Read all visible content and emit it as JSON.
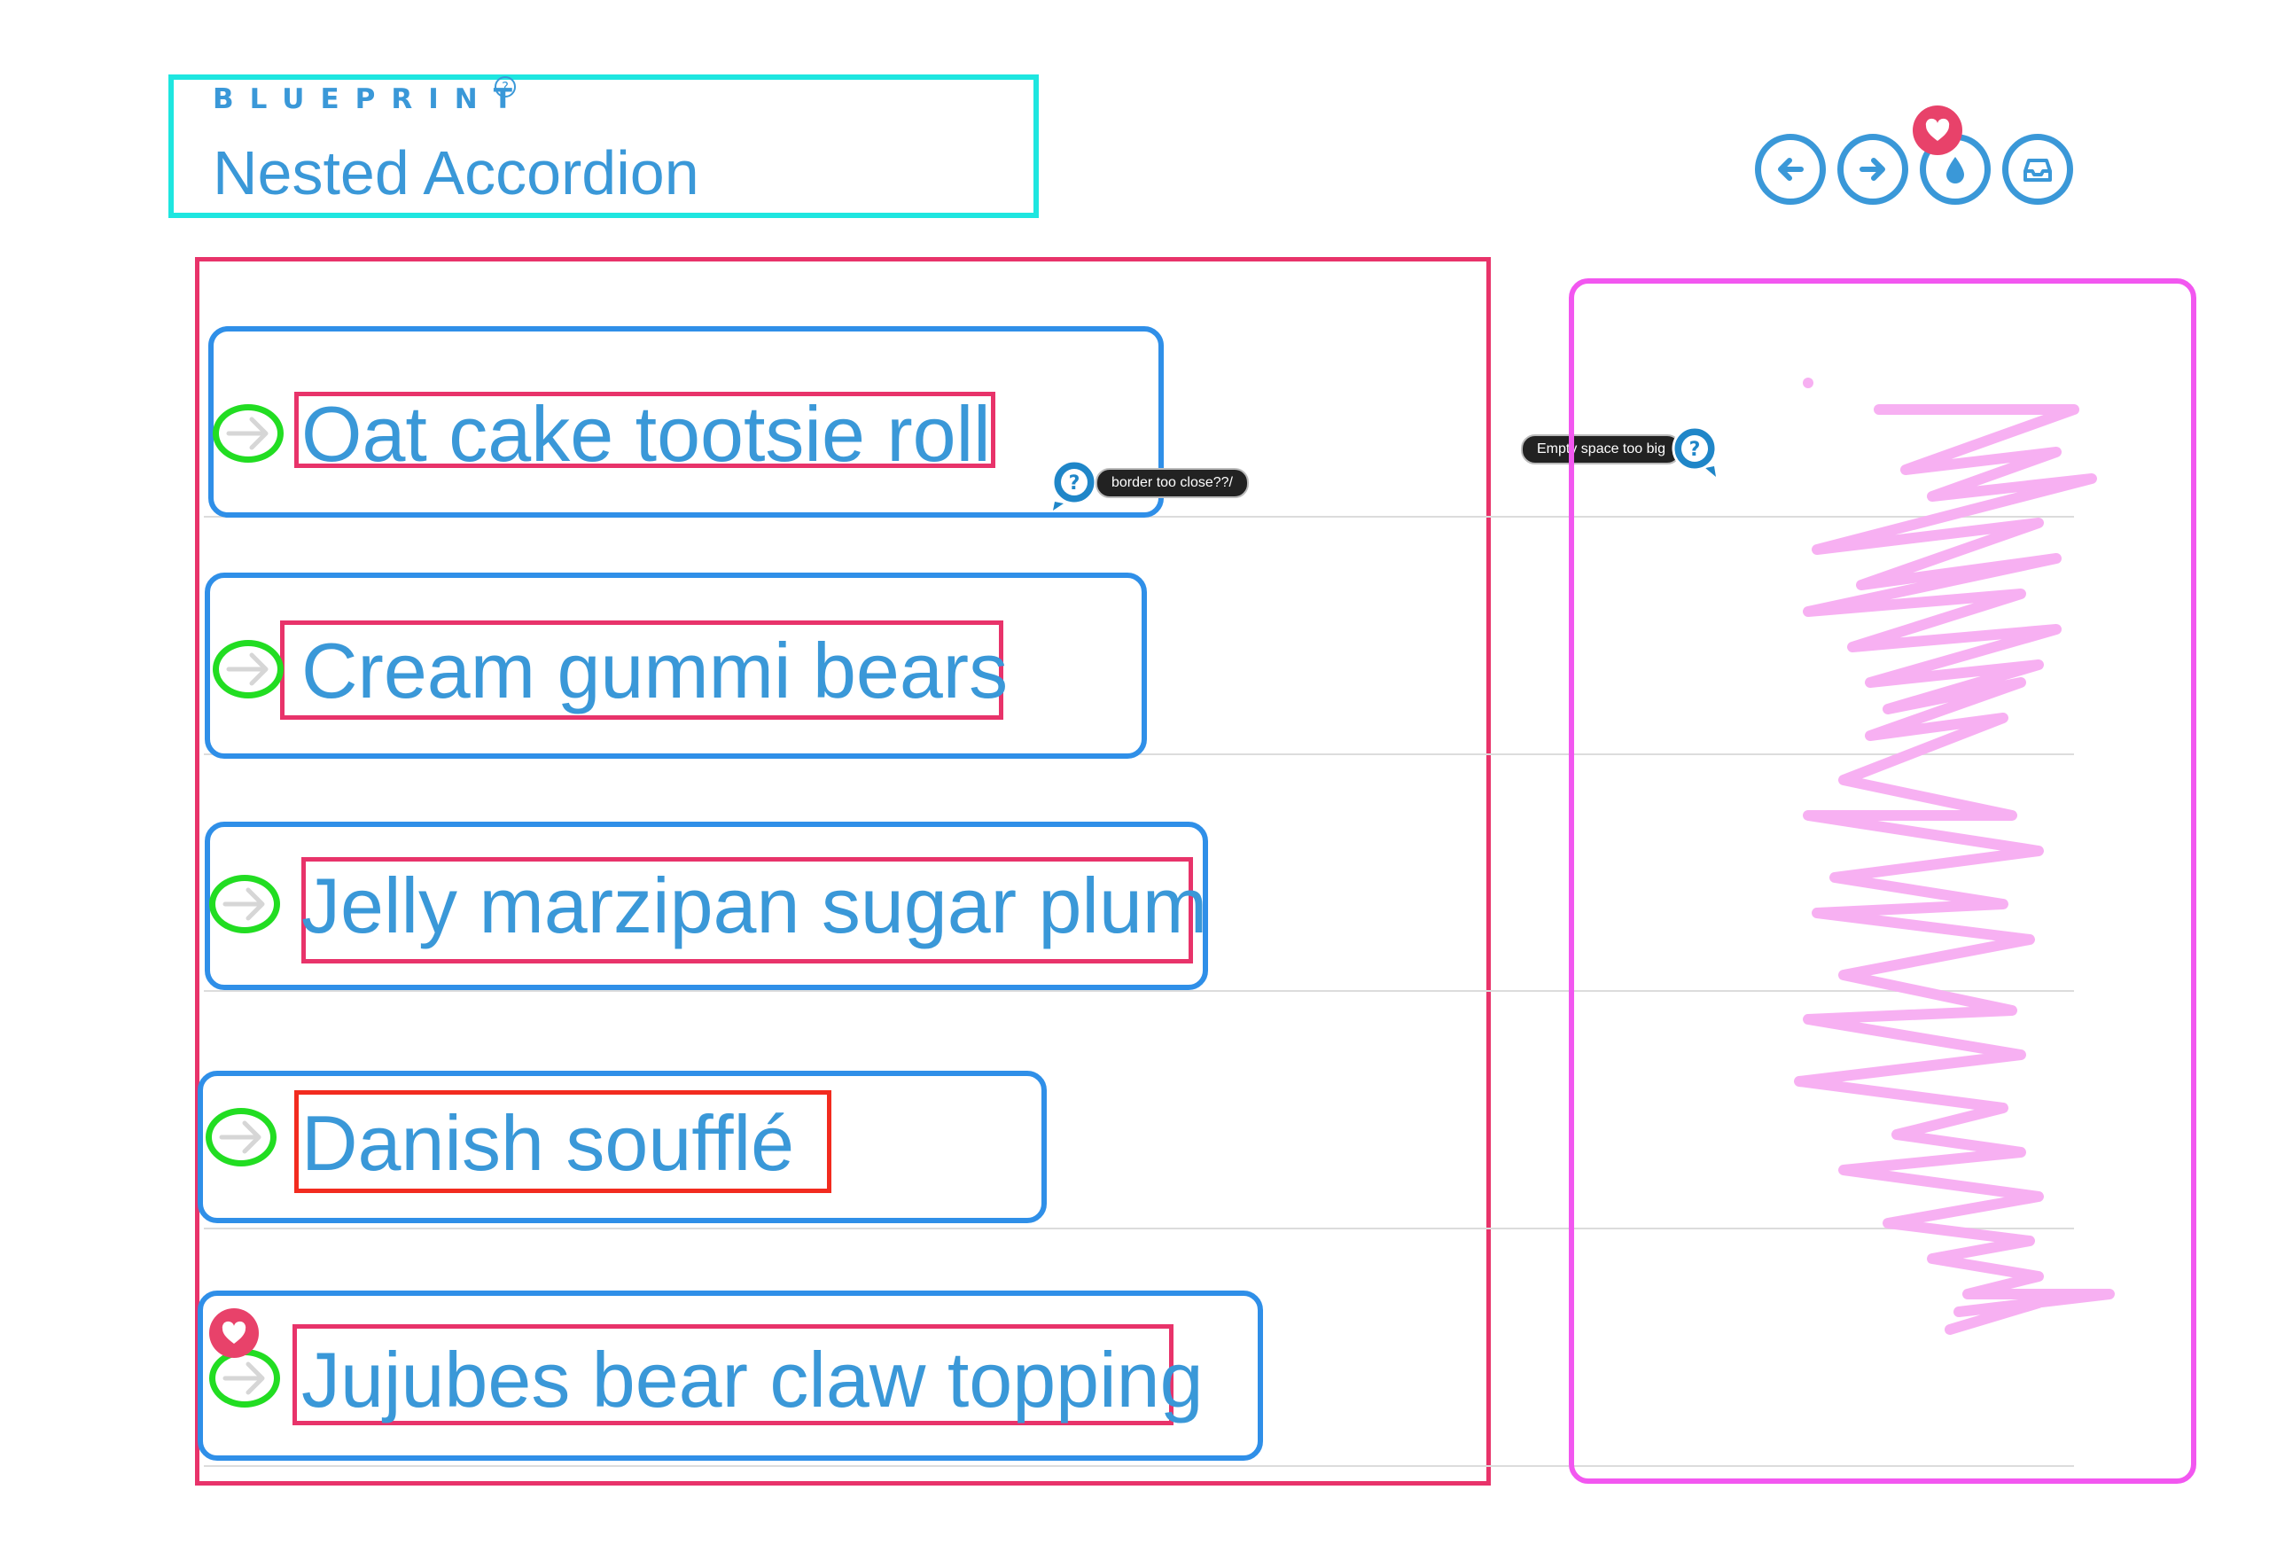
{
  "header": {
    "brand": "BLUEPRINT",
    "brand_mark": "?",
    "title": "Nested Accordion"
  },
  "toolbar": {
    "buttons": [
      {
        "name": "prev",
        "icon": "arrow-left-icon"
      },
      {
        "name": "next",
        "icon": "arrow-right-icon"
      },
      {
        "name": "color",
        "icon": "water-drop-icon"
      },
      {
        "name": "inbox",
        "icon": "inbox-icon"
      }
    ]
  },
  "accordion": {
    "items": [
      {
        "label": "Oat cake tootsie roll"
      },
      {
        "label": "Cream gummi bears"
      },
      {
        "label": "Jelly marzipan sugar plum"
      },
      {
        "label": "Danish soufflé"
      },
      {
        "label": "Jujubes bear claw topping"
      }
    ]
  },
  "comments": [
    {
      "icon": "question-icon",
      "text": "border too close??/"
    },
    {
      "icon": "question-icon",
      "text": "Empty space too big"
    }
  ],
  "colors": {
    "accent": "#3a98d8",
    "header_outline": "#1ee6e0",
    "annotation_red": "#e8336a",
    "annotation_green": "#22dd22",
    "item_outline": "#2f8fe8",
    "panel_outline": "#f257f0",
    "scribble": "#f7b0f2",
    "badge": "#e8426a"
  }
}
